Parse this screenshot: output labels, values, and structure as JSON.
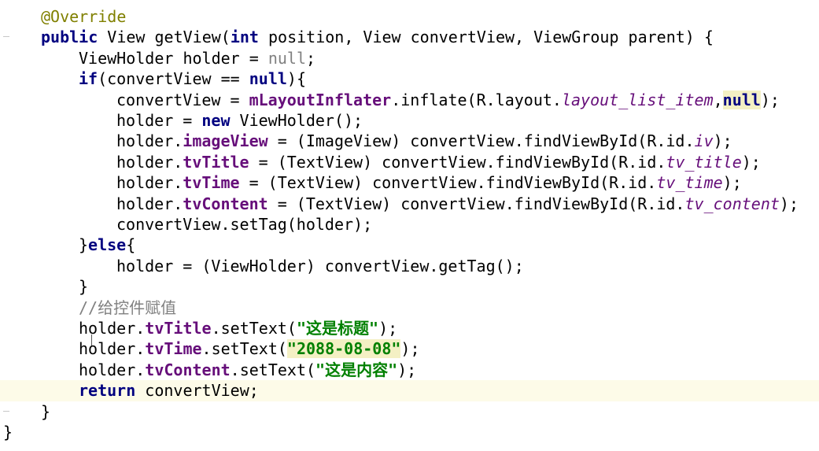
{
  "editor": {
    "lines": [
      {
        "parts": [
          {
            "t": "@Override",
            "c": "annotation"
          }
        ]
      },
      {
        "parts": [
          {
            "t": "public",
            "c": "kw"
          },
          {
            "t": " View getView("
          },
          {
            "t": "int",
            "c": "kw"
          },
          {
            "t": " position, View convertView, ViewGroup parent) {"
          }
        ]
      },
      {
        "parts": [
          {
            "t": "ViewHolder holder = "
          },
          {
            "t": "null",
            "c": "grey"
          },
          {
            "t": ";"
          }
        ]
      },
      {
        "parts": [
          {
            "t": "if",
            "c": "kw"
          },
          {
            "t": "(convertView == "
          },
          {
            "t": "null",
            "c": "kw"
          },
          {
            "t": "){"
          }
        ]
      },
      {
        "parts": [
          {
            "t": "convertView = "
          },
          {
            "t": "mLayoutInflater",
            "c": "field"
          },
          {
            "t": ".inflate(R.layout."
          },
          {
            "t": "layout_list_item",
            "c": "static"
          },
          {
            "t": ","
          },
          {
            "t": "null",
            "c": "kw hl-box"
          },
          {
            "t": ");"
          }
        ]
      },
      {
        "parts": [
          {
            "t": "holder = "
          },
          {
            "t": "new",
            "c": "kw"
          },
          {
            "t": " ViewHolder();"
          }
        ]
      },
      {
        "parts": [
          {
            "t": "holder."
          },
          {
            "t": "imageView",
            "c": "field"
          },
          {
            "t": " = (ImageView) convertView.findViewById(R.id."
          },
          {
            "t": "iv",
            "c": "static"
          },
          {
            "t": ");"
          }
        ]
      },
      {
        "parts": [
          {
            "t": "holder."
          },
          {
            "t": "tvTitle",
            "c": "field"
          },
          {
            "t": " = (TextView) convertView.findViewById(R.id."
          },
          {
            "t": "tv_title",
            "c": "static"
          },
          {
            "t": ");"
          }
        ]
      },
      {
        "parts": [
          {
            "t": "holder."
          },
          {
            "t": "tvTime",
            "c": "field"
          },
          {
            "t": " = (TextView) convertView.findViewById(R.id."
          },
          {
            "t": "tv_time",
            "c": "static"
          },
          {
            "t": ");"
          }
        ]
      },
      {
        "parts": [
          {
            "t": "holder."
          },
          {
            "t": "tvContent",
            "c": "field"
          },
          {
            "t": " = (TextView) convertView.findViewById(R.id."
          },
          {
            "t": "tv_content",
            "c": "static"
          },
          {
            "t": ");"
          }
        ]
      },
      {
        "parts": [
          {
            "t": "convertView.setTag(holder);"
          }
        ]
      },
      {
        "parts": [
          {
            "t": "}"
          },
          {
            "t": "else",
            "c": "kw"
          },
          {
            "t": "{"
          }
        ]
      },
      {
        "parts": [
          {
            "t": "holder = (ViewHolder) convertView.getTag();"
          }
        ]
      },
      {
        "parts": [
          {
            "t": "}"
          }
        ]
      },
      {
        "parts": [
          {
            "t": "//给控件赋值",
            "c": "comment"
          }
        ]
      },
      {
        "parts": [
          {
            "t": "holder."
          },
          {
            "t": "tvTitle",
            "c": "field"
          },
          {
            "t": ".setText("
          },
          {
            "t": "\"这是标题\"",
            "c": "string"
          },
          {
            "t": ");"
          }
        ]
      },
      {
        "parts": [
          {
            "t": "holder."
          },
          {
            "t": "tvTime",
            "c": "field"
          },
          {
            "t": ".setText("
          },
          {
            "t": "\"2088-08-08\"",
            "c": "string hl-yellow"
          },
          {
            "t": ");"
          }
        ]
      },
      {
        "parts": [
          {
            "t": "holder."
          },
          {
            "t": "tvContent",
            "c": "field"
          },
          {
            "t": ".setText("
          },
          {
            "t": "\"这是内容\"",
            "c": "string"
          },
          {
            "t": ");"
          }
        ]
      },
      {
        "parts": [
          {
            "t": "return",
            "c": "kw"
          },
          {
            "t": " convertView;"
          }
        ]
      },
      {
        "parts": [
          {
            "t": "}"
          }
        ]
      },
      {
        "parts": [
          {
            "t": "}"
          }
        ]
      }
    ]
  },
  "colors": {
    "keyword": "#000080",
    "field": "#660e7a",
    "string": "#008000",
    "comment": "#808080",
    "annotation": "#808000",
    "current_line": "#fdfbe8",
    "highlight": "#f4f0c4"
  }
}
